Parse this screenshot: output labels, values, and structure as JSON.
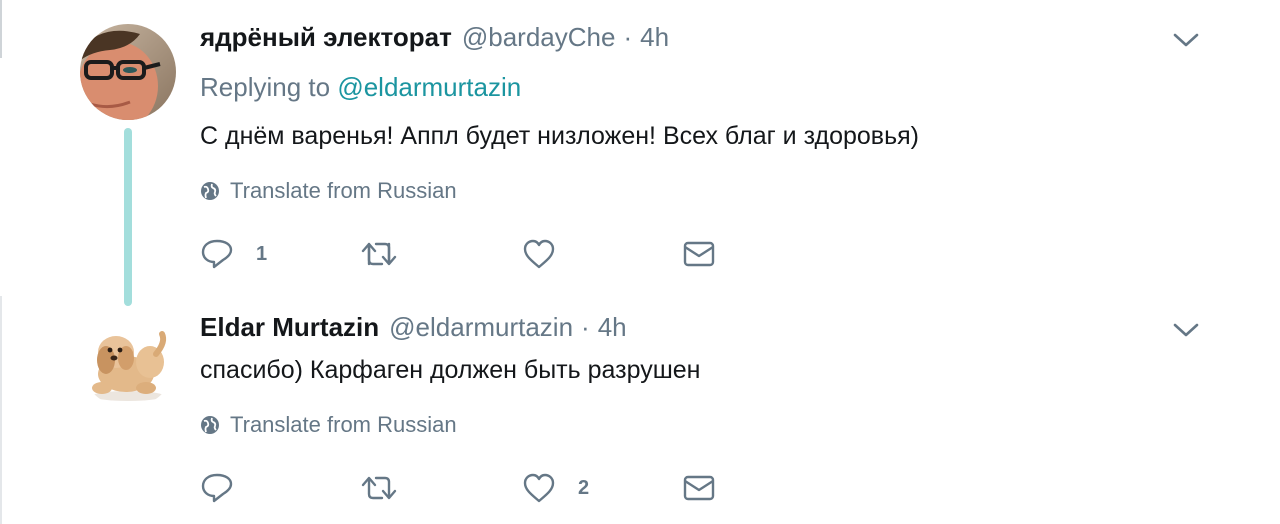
{
  "tweets": [
    {
      "name": "ядрёный электорат",
      "handle": "@bardayChe",
      "separator": "·",
      "time": "4h",
      "replying_prefix": "Replying to",
      "replying_handle": "@eldarmurtazin",
      "text": "С днём варенья! Аппл будет низложен! Всех благ и здоровья)",
      "translate_label": "Translate from Russian",
      "reply_count": "1",
      "retweet_count": "",
      "like_count": ""
    },
    {
      "name": "Eldar Murtazin",
      "handle": "@eldarmurtazin",
      "separator": "·",
      "time": "4h",
      "text": "спасибо) Карфаген должен быть разрушен",
      "translate_label": "Translate from Russian",
      "reply_count": "",
      "retweet_count": "",
      "like_count": "2"
    }
  ],
  "icons": {
    "more": "chevron-down-icon",
    "globe": "globe-icon",
    "reply": "reply-icon",
    "retweet": "retweet-icon",
    "like": "heart-icon",
    "dm": "envelope-icon"
  },
  "colors": {
    "link": "#1b95a0",
    "thread_line": "#a3dedc",
    "muted": "#657786",
    "text": "#14171a"
  }
}
